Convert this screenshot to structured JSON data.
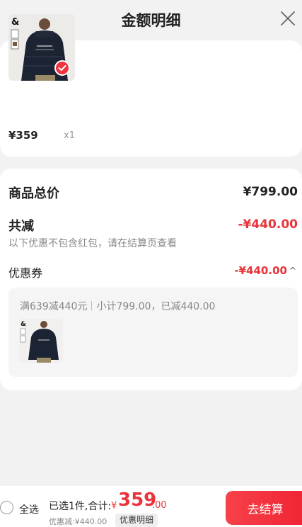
{
  "header": {
    "title": "金额明细"
  },
  "products": [
    {
      "price": "¥359",
      "qty": "x1",
      "selected": true,
      "image_icon": "black-puffer-jacket-product-image"
    }
  ],
  "summary": {
    "total_label": "商品总价",
    "total_value": "¥799.00",
    "reduction_label": "共减",
    "reduction_value": "-¥440.00",
    "note": "以下优惠不包含红包，请在结算页查看",
    "coupon_label": "优惠券",
    "coupon_value": "-¥440.00",
    "coupon_caret": "^",
    "coupon_desc_a": "满639减440元",
    "coupon_desc_b": "小计799.00，已减440.00"
  },
  "bottom": {
    "select_all": "全选",
    "selected_text": "已选1件,合计:",
    "yen": "¥",
    "amount_int": "359",
    "amount_dec": ".00",
    "discount_text": "优惠减:¥440.00",
    "detail_chip": "优惠明细",
    "checkout": "去结算"
  },
  "colors": {
    "accent": "#e8343a",
    "button": "#f0343e",
    "background": "#f2f2f2"
  }
}
